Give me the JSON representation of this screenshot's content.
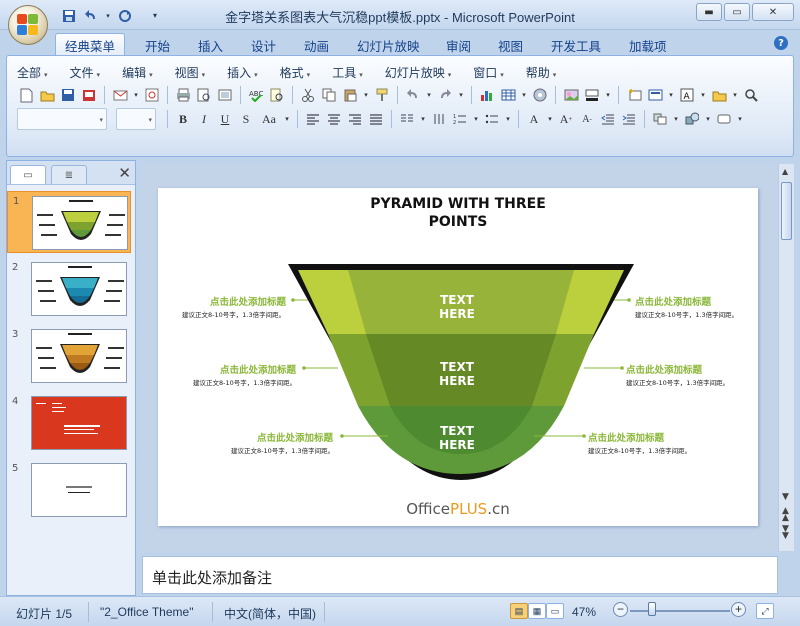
{
  "window": {
    "title": "金字塔关系图表大气沉稳ppt模板.pptx - Microsoft PowerPoint"
  },
  "ribbon_tabs": [
    "经典菜单",
    "开始",
    "插入",
    "设计",
    "动画",
    "幻灯片放映",
    "审阅",
    "视图",
    "开发工具",
    "加载项"
  ],
  "menus": [
    "全部",
    "文件",
    "编辑",
    "视图",
    "插入",
    "格式",
    "工具",
    "幻灯片放映",
    "窗口",
    "帮助"
  ],
  "thumbnails": [
    {
      "num": "1"
    },
    {
      "num": "2"
    },
    {
      "num": "3"
    },
    {
      "num": "4"
    },
    {
      "num": "5"
    }
  ],
  "slide": {
    "title_line1": "PYRAMID WITH THREE",
    "title_line2": "POINTS",
    "sections": [
      {
        "text1": "TEXT",
        "text2": "HERE"
      },
      {
        "text1": "TEXT",
        "text2": "HERE"
      },
      {
        "text1": "TEXT",
        "text2": "HERE"
      }
    ],
    "label_title": "点击此处添加标题",
    "label_desc": "建议正文8-10号字，1.3倍字间距。",
    "brand_a": "Office",
    "brand_b": "PLUS",
    "brand_c": ".cn",
    "colors": {
      "light": "#bccf3c",
      "mid": "#7ea22e",
      "dark": "#5e9a3a",
      "accent": "#8cb83a"
    }
  },
  "notes": {
    "placeholder": "单击此处添加备注"
  },
  "status": {
    "slide_info": "幻灯片 1/5",
    "theme": "\"2_Office Theme\"",
    "language": "中文(简体，中国)",
    "zoom": "47%"
  }
}
